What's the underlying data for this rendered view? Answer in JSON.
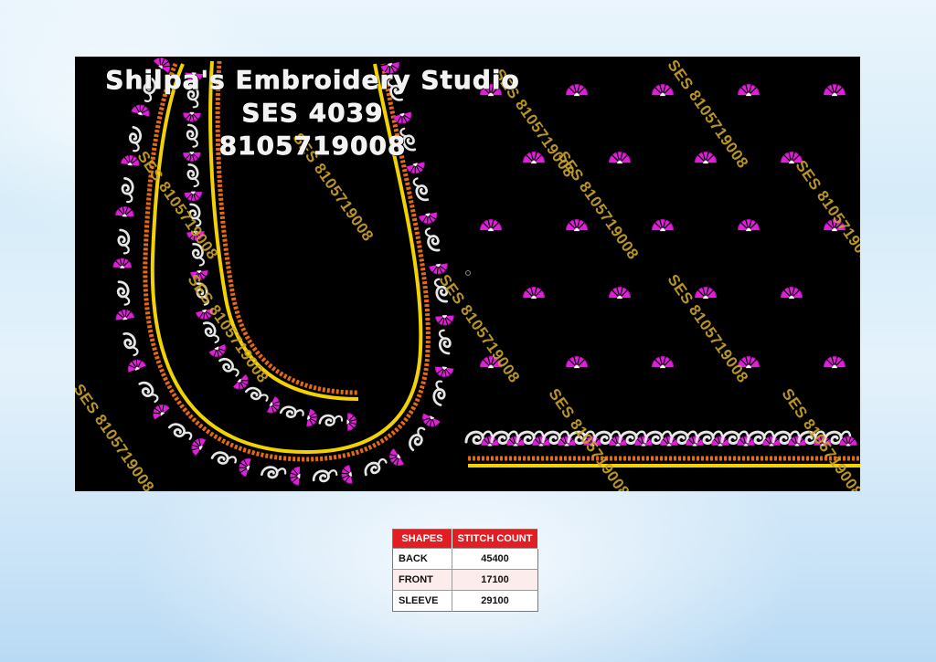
{
  "header": {
    "studio_name": "Shilpa's Embroidery Studio",
    "design_code": "SES 4039",
    "phone": "8105719008"
  },
  "watermark": {
    "text": "SES 8105719008"
  },
  "colors": {
    "background": "#000000",
    "magenta": "#e020d8",
    "white_thread": "#e8e8e8",
    "gold": "#f2d200",
    "orange": "#e86a10",
    "table_header": "#e01e24"
  },
  "table": {
    "headers": [
      "SHAPES",
      "STITCH COUNT"
    ],
    "rows": [
      {
        "shape": "BACK",
        "count": "45400"
      },
      {
        "shape": "FRONT",
        "count": "17100"
      },
      {
        "shape": "SLEEVE",
        "count": "29100"
      }
    ]
  }
}
